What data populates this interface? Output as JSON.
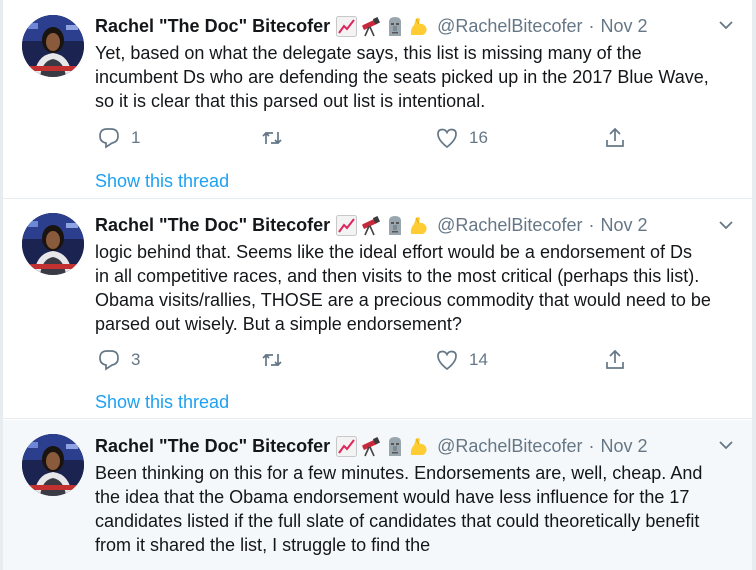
{
  "tweets": [
    {
      "display_name": "Rachel \"The Doc\" Bitecofer",
      "handle": "@RachelBitecofer",
      "separator": "·",
      "date": "Nov 2",
      "lines": [
        "Yet, based on what the delegate says, this list is missing many of the",
        "incumbent Ds who are defending the seats picked up in the 2017 Blue Wave,",
        "so it is clear that this parsed out list is intentional."
      ],
      "reply_count": "1",
      "retweet_count": "",
      "like_count": "16",
      "show_thread": "Show this thread"
    },
    {
      "display_name": "Rachel \"The Doc\" Bitecofer",
      "handle": "@RachelBitecofer",
      "separator": "·",
      "date": "Nov 2",
      "lines": [
        "logic behind that. Seems like the ideal effort would be a endorsement of Ds",
        "in all competitive races, and then visits to the most critical (perhaps this list).",
        "Obama visits/rallies, THOSE are a precious commodity that would need to be",
        "parsed out wisely. But a simple endorsement?"
      ],
      "reply_count": "3",
      "retweet_count": "",
      "like_count": "14",
      "show_thread": "Show this thread"
    },
    {
      "display_name": "Rachel \"The Doc\" Bitecofer",
      "handle": "@RachelBitecofer",
      "separator": "·",
      "date": "Nov 2",
      "lines": [
        "Been thinking on this for a few minutes. Endorsements are, well, cheap. And",
        "the idea that the Obama endorsement would have less influence for the 17",
        "candidates listed if the full slate of candidates that could theoretically benefit",
        "from it shared the list, I struggle to find the"
      ]
    }
  ],
  "icons": {
    "name_emojis": [
      "chart-increasing-icon",
      "telescope-icon",
      "moai-icon",
      "flexed-biceps-icon"
    ],
    "actions": [
      "reply-icon",
      "retweet-icon",
      "like-icon",
      "share-icon"
    ],
    "menu": "chevron-down-icon"
  },
  "colors": {
    "link": "#1da1f2",
    "secondary_text": "#657786",
    "highlight_background": "#f5f8fa"
  }
}
